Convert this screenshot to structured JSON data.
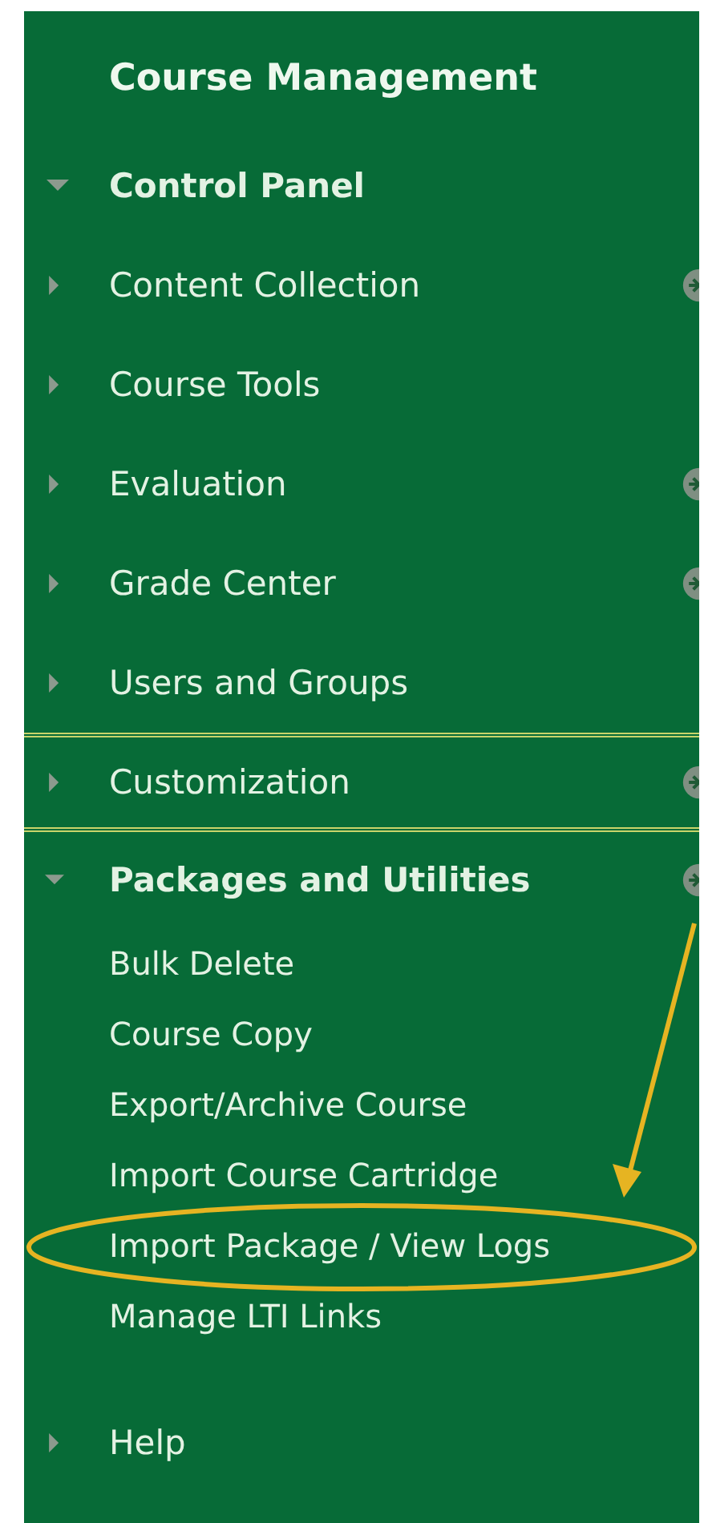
{
  "panel": {
    "title": "Course Management"
  },
  "menu": [
    {
      "label": "Control Panel",
      "expanded": true,
      "options_button": false,
      "separated": false,
      "children": [
        {
          "label": "Content Collection",
          "expanded": false,
          "options_button": true,
          "separated": false
        },
        {
          "label": "Course Tools",
          "expanded": false,
          "options_button": false,
          "separated": false
        },
        {
          "label": "Evaluation",
          "expanded": false,
          "options_button": true,
          "separated": false
        },
        {
          "label": "Grade Center",
          "expanded": false,
          "options_button": true,
          "separated": false
        },
        {
          "label": "Users and Groups",
          "expanded": false,
          "options_button": false,
          "separated": false
        },
        {
          "label": "Customization",
          "expanded": false,
          "options_button": true,
          "separated": true
        },
        {
          "label": "Packages and Utilities",
          "expanded": true,
          "options_button": true,
          "separated": false,
          "children": [
            {
              "label": "Bulk Delete",
              "highlighted": false
            },
            {
              "label": "Course Copy",
              "highlighted": false
            },
            {
              "label": "Export/Archive Course",
              "highlighted": false
            },
            {
              "label": "Import Course Cartridge",
              "highlighted": false
            },
            {
              "label": "Import Package / View Logs",
              "highlighted": true
            },
            {
              "label": "Manage LTI Links",
              "highlighted": false
            }
          ]
        }
      ]
    },
    {
      "label": "Help",
      "expanded": false,
      "options_button": false,
      "separated": false
    }
  ]
}
